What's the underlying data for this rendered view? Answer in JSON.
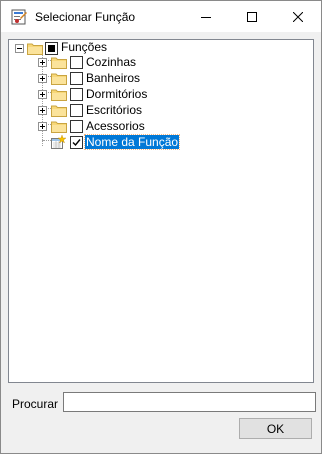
{
  "window": {
    "title": "Selecionar Função",
    "app_icon": "form-icon"
  },
  "title_controls": {
    "minimize_icon": "minimize-icon",
    "maximize_icon": "maximize-icon",
    "close_icon": "close-icon"
  },
  "tree": {
    "root": {
      "label": "Funções",
      "expanded": true,
      "check_state": "indeterminate"
    },
    "children": [
      {
        "label": "Cozinhas",
        "expanded": false,
        "checked": false
      },
      {
        "label": "Banheiros",
        "expanded": false,
        "checked": false
      },
      {
        "label": "Dormitórios",
        "expanded": false,
        "checked": false
      },
      {
        "label": "Escritórios",
        "expanded": false,
        "checked": false
      },
      {
        "label": "Acessorios",
        "expanded": false,
        "checked": false
      },
      {
        "label": "Nome da Função",
        "checked": true,
        "selected": true,
        "icon": "new-item-icon"
      }
    ]
  },
  "search": {
    "label": "Procurar",
    "value": "",
    "placeholder": ""
  },
  "buttons": {
    "ok_label": "OK"
  }
}
